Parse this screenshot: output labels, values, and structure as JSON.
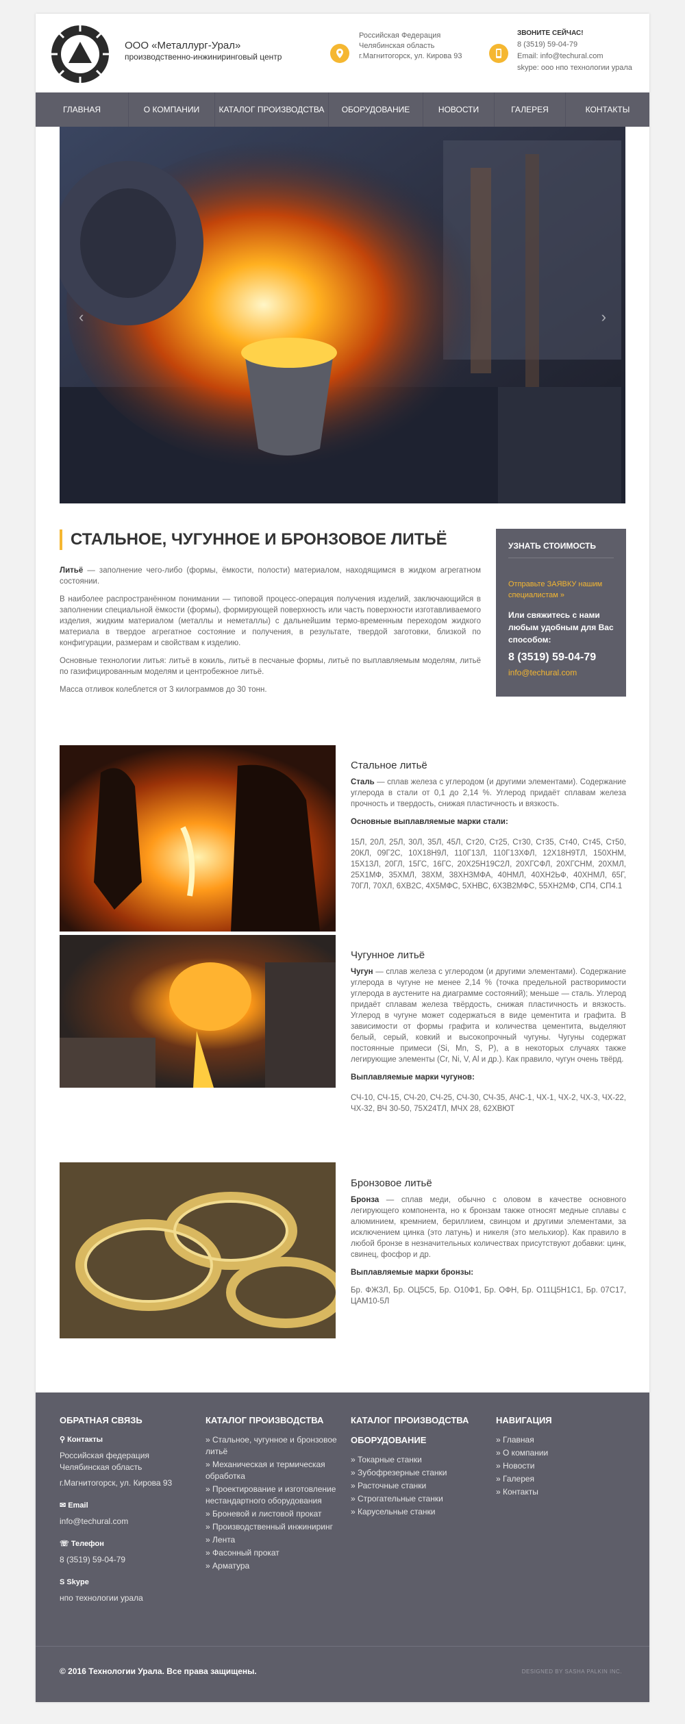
{
  "header": {
    "company_name": "ООО «Металлург-Урал»",
    "company_sub": "производственно-инжиниринговый центр",
    "address": [
      "Российская Федерация",
      "Челябинская область",
      "г.Магнитогорск, ул. Кирова 93"
    ],
    "call_now": "ЗВОНИТЕ СЕЙЧАС!",
    "phone": "8 (3519) 59-04-79",
    "email": "Email: info@techural.com",
    "skype": "skype: ооо нпо технологии урала"
  },
  "nav": [
    "Главная",
    "О компании",
    "Каталог производства",
    "Оборудование",
    "Новости",
    "Галерея",
    "Контакты"
  ],
  "section": {
    "title": "СТАЛЬНОЕ, ЧУГУННОЕ И БРОНЗОВОЕ ЛИТЬЁ",
    "p1_bold": "Литьё",
    "p1": " — заполнение чего-либо (формы, ёмкости, полости) материалом, находящимся в жидком агрегатном состоянии.",
    "p2": "В наиболее распространённом понимании — типовой процесс-операция получения изделий, заключающийся в заполнении специальной ёмкости (формы), формирующей поверхность или часть поверхности изготавливаемого изделия, жидким материалом (металлы и неметаллы) с дальнейшим термо-временным переходом жидкого материала в твердое агрегатное состояние и получения, в результате, твердой заготовки, близкой по конфигурации, размерам и свойствам к изделию.",
    "p3": "Основные технологии литья: литьё в кокиль, литьё в песчаные формы, литьё по выплавляемым моделям, литьё по газифицированным моделям и центробежное литьё.",
    "p4": "Масса отливок колеблется от 3 килограммов до 30 тонн."
  },
  "cta": {
    "title": "УЗНАТЬ СТОИМОСТЬ",
    "link": "Отправьте ЗАЯВКУ нашим специалистам »",
    "text": "Или свяжитесь с нами любым удобным для Вас способом:",
    "phone": "8 (3519) 59-04-79",
    "email": "info@techural.com"
  },
  "products": [
    {
      "title": "Стальное литьё",
      "term": "Сталь",
      "desc": " — сплав железа с углеродом (и другими элементами). Содержание углерода в стали от 0,1 до 2,14 %. Углерод придаёт сплавам железа прочность и твердость, снижая пластичность и вязкость.",
      "grades_title": "Основные выплавляемые марки стали:",
      "grades": "15Л, 20Л, 25Л, 30Л, 35Л, 45Л, Ст20, Ст25, Ст30, Ст35, Ст40, Ст45, Ст50, 20КЛ, 09Г2С, 10Х18Н9Л, 110Г13Л, 110Г13ХФЛ, 12Х18Н9ТЛ, 150ХНМ, 15Х13Л, 20ГЛ, 15ГС, 16ГС, 20Х25Н19С2Л, 20ХГСФЛ, 20ХГСНМ, 20ХМЛ, 25Х1МФ, 35ХМЛ, 38ХМ, 38ХН3МФА, 40НМЛ, 40ХН2ЬФ, 40ХНМЛ, 65Г, 70ГЛ, 70ХЛ, 6ХВ2С, 4Х5МФС, 5ХНВС, 6Х3В2МФС, 55ХН2МФ, СП4, СП4.1"
    },
    {
      "title": "Чугунное литьё",
      "term": "Чугун",
      "desc": " — сплав железа с углеродом (и другими элементами). Содержание углерода в чугуне не менее 2,14 % (точка предельной растворимости углерода в аустените на диаграмме состояний); меньше — сталь. Углерод придаёт сплавам железа твёрдость, снижая пластичность и вязкость. Углерод в чугуне может содержаться в виде цементита и графита. В зависимости от формы графита и количества цементита, выделяют белый, серый, ковкий и высокопрочный чугуны. Чугуны содержат постоянные примеси (Si, Mn, S, P), а в некоторых случаях также легирующие элементы (Cr, Ni, V, Al и др.). Как правило, чугун очень твёрд.",
      "grades_title": "Выплавляемые марки чугунов:",
      "grades": "СЧ-10, СЧ-15, СЧ-20, СЧ-25, СЧ-30, СЧ-35, АЧС-1, ЧХ-1, ЧХ-2, ЧХ-3, ЧХ-22, ЧХ-32, ВЧ 30-50, 75Х24ТЛ, МЧХ 28, 62ХВЮТ"
    },
    {
      "title": "Бронзовое литьё",
      "term": "Бронза",
      "desc": " — сплав меди, обычно с оловом в качестве основного легирующего компонента, но к бронзам также относят медные сплавы с алюминием, кремнием, бериллием, свинцом и другими элементами, за исключением цинка (это латунь) и никеля (это мельхиор). Как правило в любой бронзе в незначительных количествах присутствуют добавки: цинк, свинец, фосфор и др.",
      "grades_title": "Выплавляемые марки бронзы:",
      "grades": "Бр. ФЖ3Л, Бр. ОЦ5С5, Бр. О10Ф1, Бр. ОФН, Бр. О11Ц5Н1С1, Бр. 07С17, ЦАМ10-5Л"
    }
  ],
  "footer": {
    "feedback_title": "ОБРАТНАЯ СВЯЗЬ",
    "contacts_label": "Контакты",
    "contacts": [
      "Российская федерация",
      "Челябинская область",
      "г.Магнитогорск, ул. Кирова 93"
    ],
    "email_label": "Email",
    "email": "info@techural.com",
    "phone_label": "Телефон",
    "phone": "8 (3519) 59-04-79",
    "skype_label": "Skype",
    "skype": "нпо технологии урала",
    "catalog_title": "КАТАЛОГ ПРОИЗВОДСТВА",
    "catalog": [
      "Стальное, чугунное и бронзовое литьё",
      "Механическая и термическая обработка",
      "Проектирование и изготовление нестандартного оборудования",
      "Броневой и листовой прокат",
      "Производственный инжиниринг",
      "Лента",
      "Фасонный прокат",
      "Арматура"
    ],
    "catalog2_title": "КАТАЛОГ ПРОИЗВОДСТВА",
    "equipment_title": "ОБОРУДОВАНИЕ",
    "equipment": [
      "Токарные станки",
      "Зубофрезерные станки",
      "Расточные станки",
      "Строгательные станки",
      "Карусельные станки"
    ],
    "nav_title": "НАВИГАЦИЯ",
    "nav": [
      "Главная",
      "О компании",
      "Новости",
      "Галерея",
      "Контакты"
    ],
    "copyright": "© 2016 Технологии Урала. Все права защищены.",
    "credit": "DESIGNED BY SASHA PALKIN INC."
  }
}
